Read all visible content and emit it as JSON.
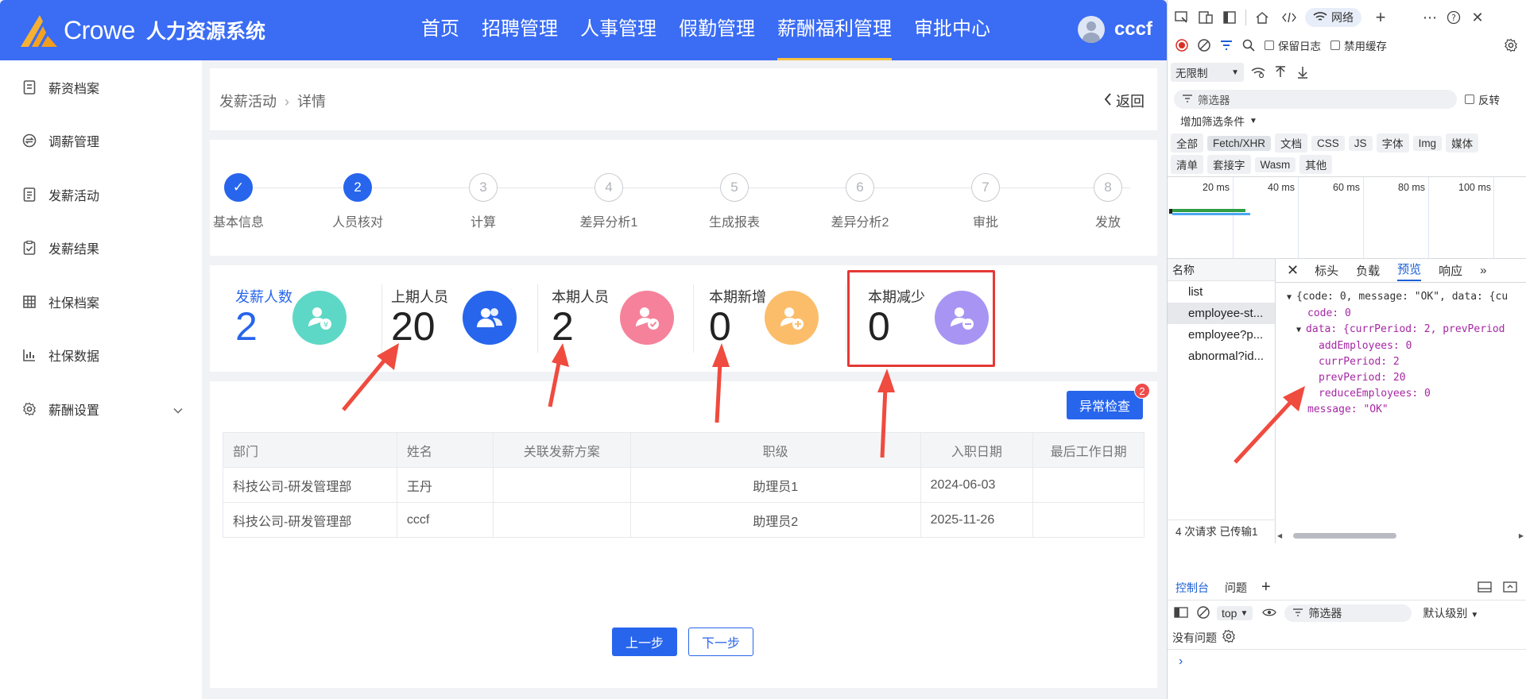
{
  "app": {
    "brand": "Crowe",
    "system_name": "人力资源系统",
    "nav": [
      "首页",
      "招聘管理",
      "人事管理",
      "假勤管理",
      "薪酬福利管理",
      "审批中心"
    ],
    "active_nav": "薪酬福利管理",
    "user_name": "cccf"
  },
  "sidebar": {
    "items": [
      {
        "label": "薪资档案",
        "icon": "document-icon"
      },
      {
        "label": "调薪管理",
        "icon": "exchange-icon"
      },
      {
        "label": "发薪活动",
        "icon": "list-icon"
      },
      {
        "label": "发薪结果",
        "icon": "clipboard-check-icon"
      },
      {
        "label": "社保档案",
        "icon": "grid-icon"
      },
      {
        "label": "社保数据",
        "icon": "bar-chart-icon"
      },
      {
        "label": "薪酬设置",
        "icon": "gear-icon"
      }
    ]
  },
  "breadcrumb": {
    "parent": "发薪活动",
    "current": "详情",
    "back": "返回"
  },
  "steps": [
    {
      "num": "✓",
      "label": "基本信息",
      "state": "done"
    },
    {
      "num": "2",
      "label": "人员核对",
      "state": "current"
    },
    {
      "num": "3",
      "label": "计算",
      "state": "todo"
    },
    {
      "num": "4",
      "label": "差异分析1",
      "state": "todo"
    },
    {
      "num": "5",
      "label": "生成报表",
      "state": "todo"
    },
    {
      "num": "6",
      "label": "差异分析2",
      "state": "todo"
    },
    {
      "num": "7",
      "label": "审批",
      "state": "todo"
    },
    {
      "num": "8",
      "label": "发放",
      "state": "todo"
    }
  ],
  "stats": [
    {
      "label": "发薪人数",
      "value": "2",
      "color": "#5ed8c6",
      "icon": "user-yuan-icon"
    },
    {
      "label": "上期人员",
      "value": "20",
      "color": "#2765ec",
      "icon": "users-icon"
    },
    {
      "label": "本期人员",
      "value": "2",
      "color": "#f5829a",
      "icon": "user-check-icon"
    },
    {
      "label": "本期新增",
      "value": "0",
      "color": "#fbbd6a",
      "icon": "user-plus-icon"
    },
    {
      "label": "本期减少",
      "value": "0",
      "color": "#a895f3",
      "icon": "user-minus-icon"
    }
  ],
  "table": {
    "abnormal_button": "异常检查",
    "abnormal_badge": "2",
    "columns": [
      "部门",
      "姓名",
      "关联发薪方案",
      "职级",
      "入职日期",
      "最后工作日期"
    ],
    "rows": [
      [
        "科技公司-研发管理部",
        "王丹",
        "",
        "助理员1",
        "2024-06-03",
        ""
      ],
      [
        "科技公司-研发管理部",
        "cccf",
        "",
        "助理员2",
        "2025-11-26",
        ""
      ]
    ],
    "prev": "上一步",
    "next": "下一步"
  },
  "devtools": {
    "tabs": {
      "network": "网络"
    },
    "preserve_log": "保留日志",
    "disable_cache": "禁用缓存",
    "throttle": "无限制",
    "filter_placeholder": "筛选器",
    "invert": "反转",
    "more_filters": "增加筛选条件",
    "type_chips": [
      "全部",
      "Fetch/XHR",
      "文档",
      "CSS",
      "JS",
      "字体",
      "Img",
      "媒体"
    ],
    "type_chips2": [
      "清单",
      "套接字",
      "Wasm",
      "其他"
    ],
    "timeline_labels": [
      "20 ms",
      "40 ms",
      "60 ms",
      "80 ms",
      "100 ms"
    ],
    "name_header": "名称",
    "requests": [
      "list",
      "employee-st...",
      "employee?p...",
      "abnormal?id..."
    ],
    "footer": "4 次请求  已传输1",
    "preview_tabs": [
      "标头",
      "负载",
      "预览",
      "响应"
    ],
    "console_tabs": [
      "控制台",
      "问题"
    ],
    "context": "top",
    "console_filter": "筛选器",
    "level": "默认级别",
    "no_issues": "没有问题",
    "json_lines": [
      "{code: 0, message: \"OK\", data: {cu",
      "code: 0",
      "data: {currPeriod: 2, prevPeriod",
      "addEmployees: 0",
      "currPeriod: 2",
      "prevPeriod: 20",
      "reduceEmployees: 0",
      "message: \"OK\""
    ]
  }
}
